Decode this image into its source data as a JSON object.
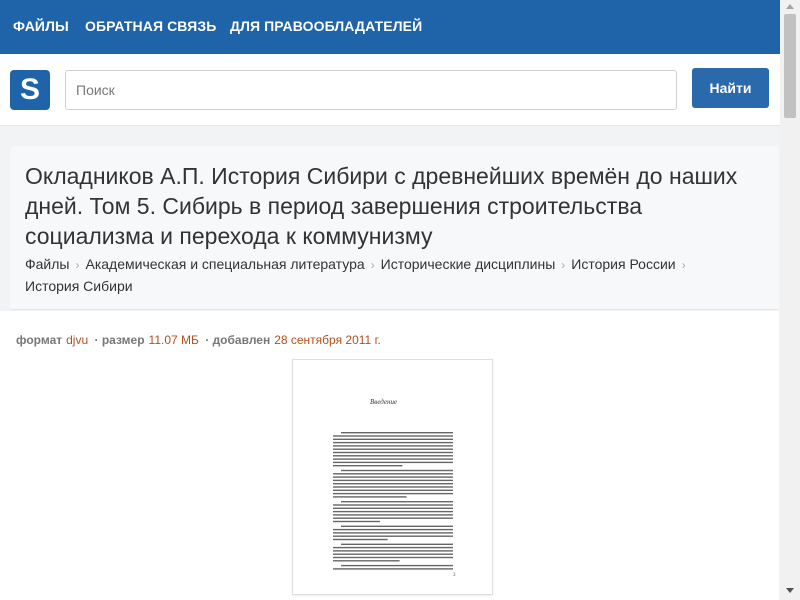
{
  "nav": {
    "items": [
      {
        "label": "ФАЙЛЫ"
      },
      {
        "label": "ОБРАТНАЯ СВЯЗЬ"
      },
      {
        "label": "ДЛЯ ПРАВООБЛАДАТЕЛЕЙ"
      }
    ]
  },
  "logo": {
    "letter": "S"
  },
  "search": {
    "placeholder": "Поиск",
    "value": "",
    "button_label": "Найти"
  },
  "document": {
    "title": "Окладников А.П. История Сибири с древнейших времён до наших дней. Том 5. Сибирь в период завершения строительства социализма и перехода к коммунизму",
    "breadcrumb": [
      "Файлы",
      "Академическая и специальная литература",
      "Исторические дисциплины",
      "История России",
      "История Сибири"
    ],
    "meta": {
      "format_label": "формат",
      "format_value": "djvu",
      "size_label": "размер",
      "size_value": "11.07 МБ",
      "added_label": "добавлен",
      "added_value": "28 сентября 2011 г."
    },
    "preview": {
      "heading": "Введение",
      "page_number": "3"
    }
  },
  "colors": {
    "brand": "#1f63a8",
    "button": "#2a6aac",
    "meta_value": "#b3501d"
  }
}
